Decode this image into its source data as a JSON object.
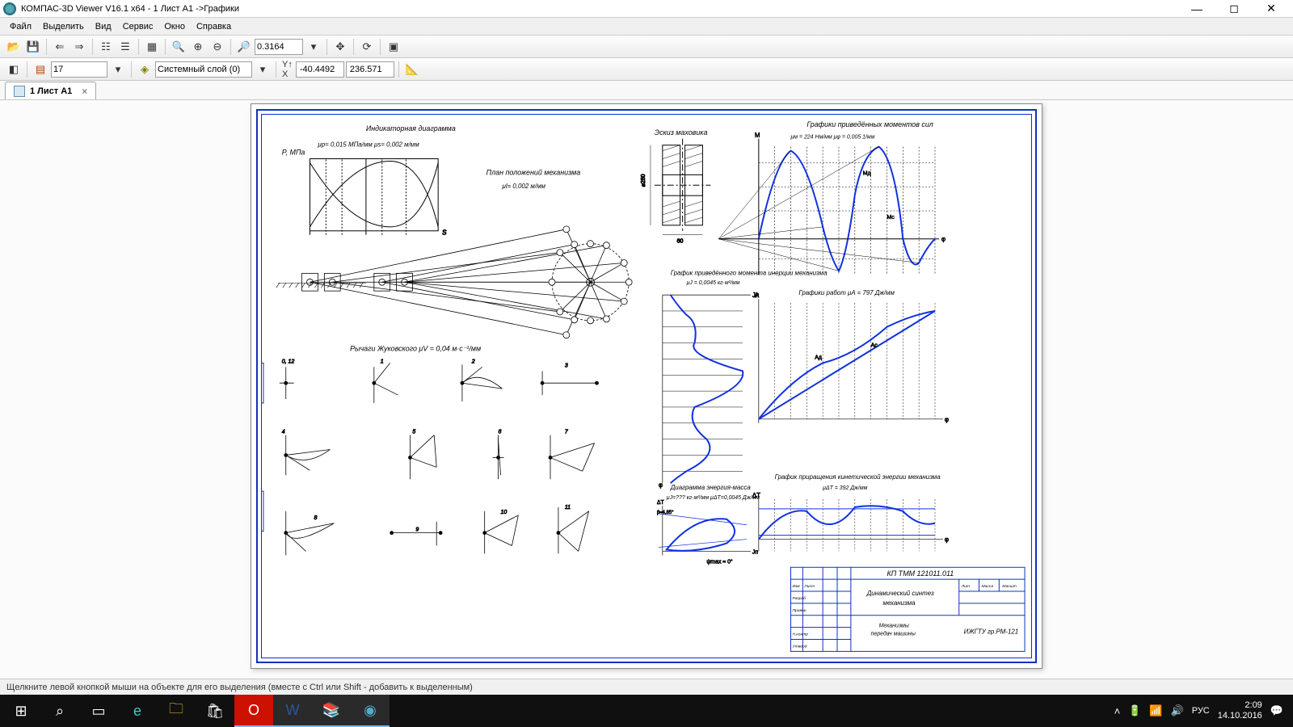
{
  "window": {
    "title": "КОМПАС-3D Viewer V16.1 x64 - 1 Лист А1 ->Графики"
  },
  "menu": {
    "file": "Файл",
    "select": "Выделить",
    "view": "Вид",
    "service": "Сервис",
    "window": "Окно",
    "help": "Справка"
  },
  "toolbar1": {
    "zoom_value": "0.3164"
  },
  "toolbar2": {
    "number": "17",
    "layer": "Системный слой (0)",
    "coord_x": "-40.4492",
    "coord_y": "236.571"
  },
  "doctab": {
    "label": "1 Лист А1"
  },
  "drawing": {
    "stamp_code": "КП ТММ 121011.011",
    "stamp_title1": "Динамический синтез",
    "stamp_title2": "механизма",
    "stamp_sub1": "Механизмы",
    "stamp_sub2": "передач машины",
    "stamp_org": "ИЖГТУ гр.РМ-121",
    "label_indicator": "Индикаторная диаграмма",
    "label_indicator_y": "P, МПа",
    "label_indicator_mu1": "μp= 0,015 МПа/мм   μs= 0,002 м/мм",
    "label_plan": "План положений механизма",
    "label_plan_mu": "μl= 0,002 м/мм",
    "label_flywheel": "Эскиз маховика",
    "label_moments": "Графики приведённых моментов сил",
    "label_moments_mu": "μм = 224 Нм/мм   μφ = 0,005 1/мм",
    "label_inertia": "График приведённого момента инерции механизма",
    "label_inertia_mu": "μJ = 0,0045 кг·м²/мм",
    "label_works": "Графики работ   μA = 797 Дж/мм",
    "label_kinetic": "График приращения кинетической энергии механизма",
    "label_kinetic_mu": "μΔT = 392 Дж/мм",
    "label_wittenbauer": "Диаграмма энергия-масса",
    "label_witten_mu": "μJ=??? кг·м²/мм   μΔT=0,0045 Дж/мм",
    "label_zhukovsky": "Рычаги Жуковского   μV = 0,04 м·с⁻¹/мм",
    "zhuk_0": "0, 12",
    "zhuk_1": "1",
    "zhuk_2": "2",
    "zhuk_3": "3",
    "zhuk_4": "4",
    "zhuk_5": "5",
    "zhuk_6": "6",
    "zhuk_7": "7",
    "zhuk_8": "8",
    "zhuk_9": "9",
    "zhuk_10": "10",
    "zhuk_11": "11"
  },
  "status": {
    "text": "Щелкните левой кнопкой мыши на объекте для его выделения (вместе с Ctrl или Shift - добавить к выделенным)"
  },
  "taskbar": {
    "lang": "РУС",
    "time": "2:09",
    "date": "14.10.2016"
  }
}
